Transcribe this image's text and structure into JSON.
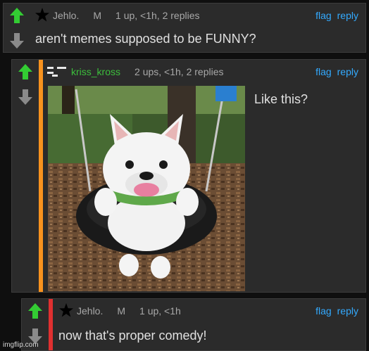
{
  "comments": [
    {
      "username": "Jehlo.",
      "mod_badge": "M",
      "stats": "1 up, <1h, 2 replies",
      "text": "aren't memes supposed to be FUNNY?",
      "flag": "flag",
      "reply": "reply",
      "upvoted": true
    },
    {
      "username": "kriss_kross",
      "stats": "2 ups, <1h, 2 replies",
      "text": "Like this?",
      "flag": "flag",
      "reply": "reply",
      "upvoted": true,
      "rank_color": "#f7921e"
    },
    {
      "username": "Jehlo.",
      "mod_badge": "M",
      "stats": "1 up, <1h",
      "text": "now that's proper comedy!",
      "flag": "flag",
      "reply": "reply",
      "upvoted": true,
      "rank_color": "#e03030"
    }
  ],
  "watermark": "imgflip.com",
  "colors": {
    "upvote": "#33cc33",
    "downvote": "#8a8a8a",
    "link": "#33aaff",
    "username_green": "#3cbe3c"
  }
}
